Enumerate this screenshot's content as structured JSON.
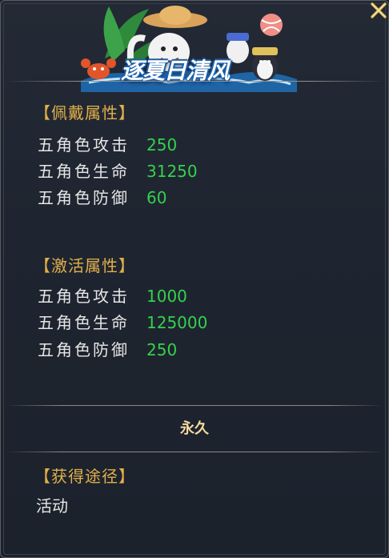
{
  "banner": {
    "title": "逐夏日清风"
  },
  "wear_section": {
    "title": "【佩戴属性】",
    "attrs": [
      {
        "name": "五角色攻击",
        "value": "250"
      },
      {
        "name": "五角色生命",
        "value": "31250"
      },
      {
        "name": "五角色防御",
        "value": "60"
      }
    ]
  },
  "activate_section": {
    "title": "【激活属性】",
    "attrs": [
      {
        "name": "五角色攻击",
        "value": "1000"
      },
      {
        "name": "五角色生命",
        "value": "125000"
      },
      {
        "name": "五角色防御",
        "value": "250"
      }
    ]
  },
  "duration": "永久",
  "acquire_section": {
    "title": "【获得途径】",
    "method": "活动"
  },
  "colors": {
    "section_title": "#e2b04a",
    "attr_name": "#e6e6e6",
    "attr_value": "#35d14e",
    "duration": "#f3d9a0",
    "background": "#1f2530"
  },
  "icons": [
    "close-icon",
    "palm-leaf-icon",
    "crab-icon",
    "hat-character-icon",
    "beach-ball-icon",
    "penguin-icon"
  ]
}
